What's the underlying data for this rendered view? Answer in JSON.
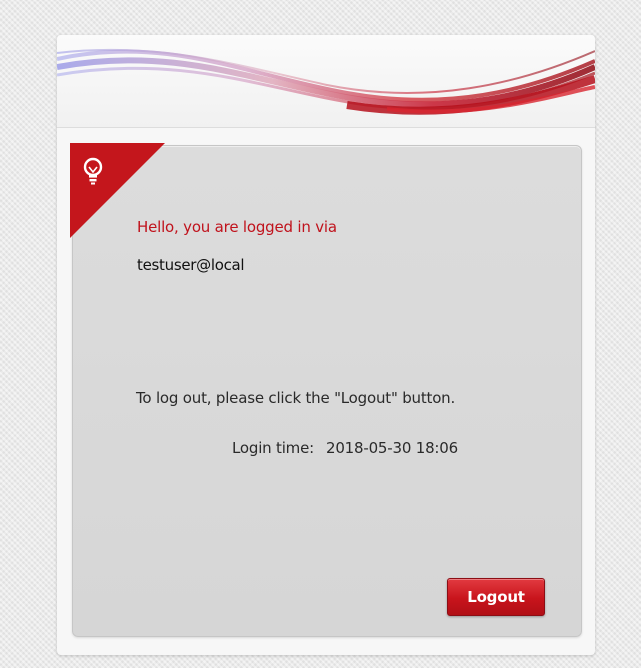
{
  "panel": {
    "greeting": "Hello, you are logged in via",
    "user": "testuser@local",
    "instruction": "To log out, please click the \"Logout\" button.",
    "login_time_label": "Login time:",
    "login_time_value": "2018-05-30 18:06",
    "logout_label": "Logout"
  },
  "icons": {
    "corner_badge": "lightbulb-icon"
  },
  "colors": {
    "accent": "#c0121c",
    "button": "#c8141c",
    "panel": "#d9d9d9"
  }
}
